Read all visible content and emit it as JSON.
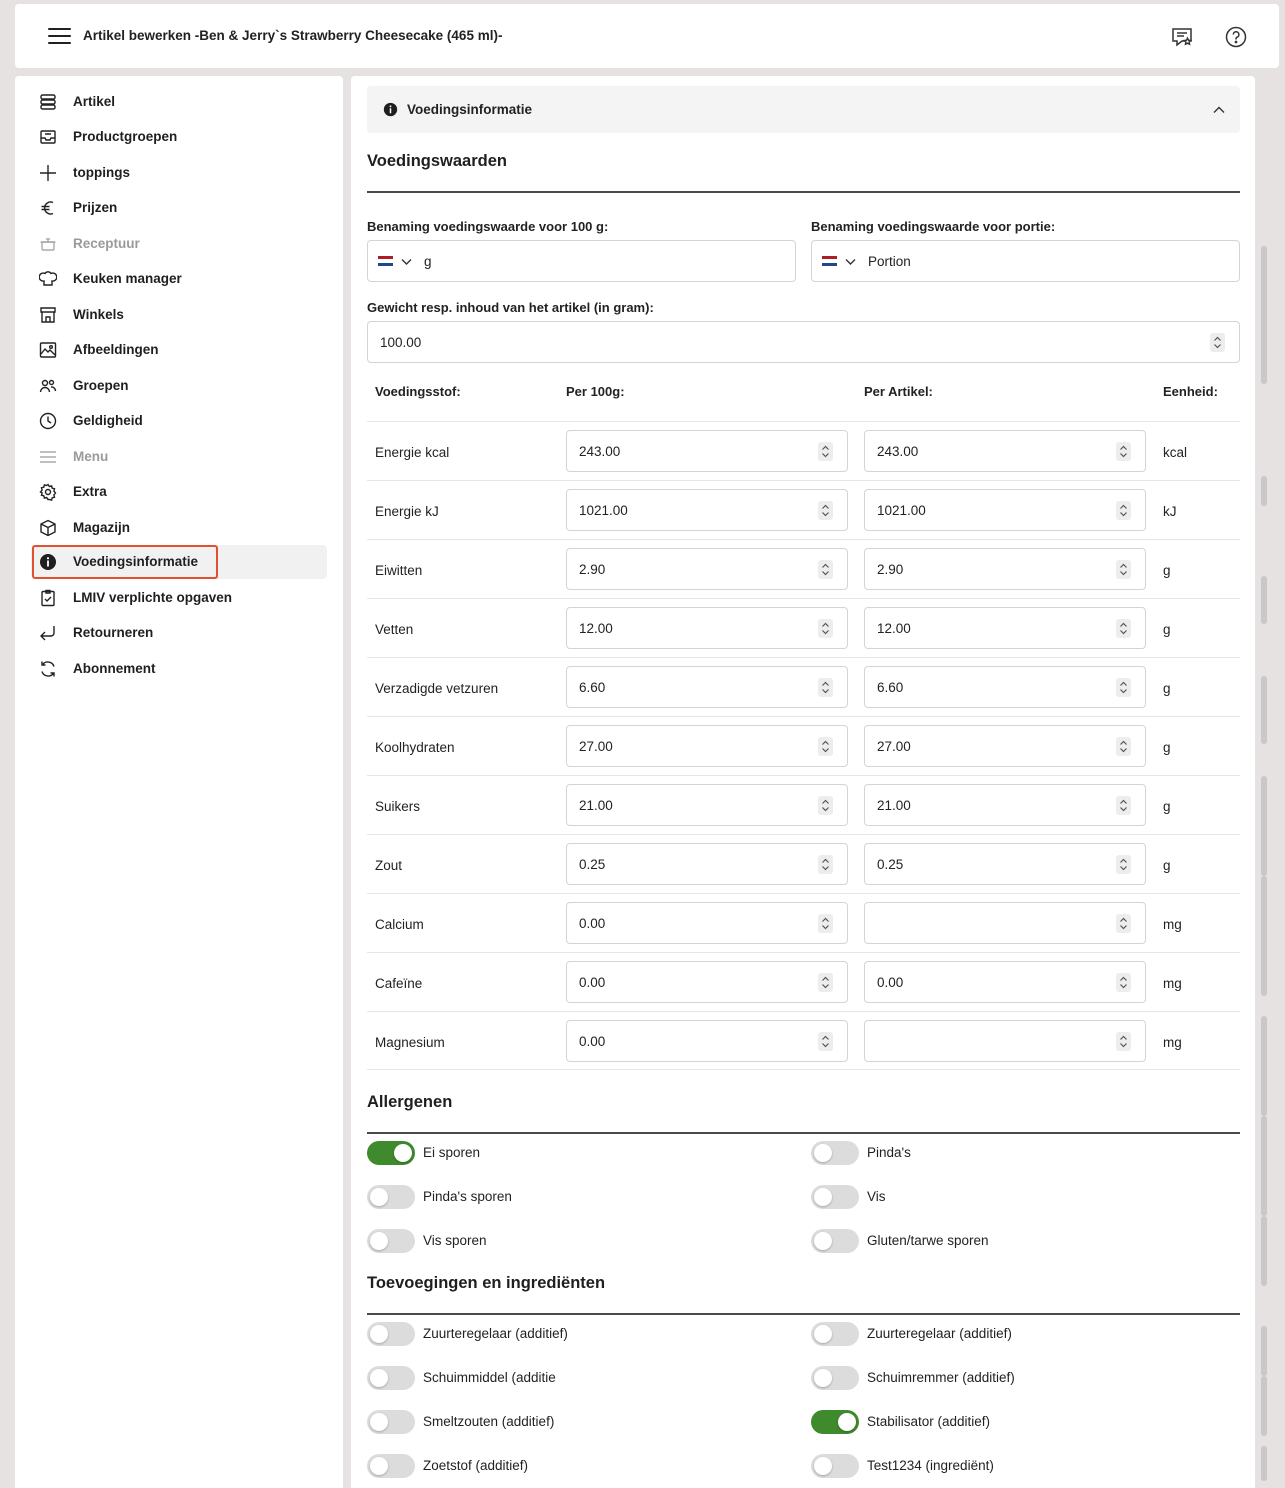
{
  "header": {
    "title": "Artikel bewerken -Ben & Jerry`s Strawberry Cheesecake (465 ml)-",
    "menu_icon": "hamburger-menu-icon",
    "feedback_icon": "feedback-star-icon",
    "help_icon": "help-circle-icon"
  },
  "sidebar": {
    "items": [
      {
        "label": "Artikel",
        "icon": "database-icon"
      },
      {
        "label": "Productgroepen",
        "icon": "inbox-tray-icon"
      },
      {
        "label": "toppings",
        "icon": "plus-icon"
      },
      {
        "label": "Prijzen",
        "icon": "euro-icon"
      },
      {
        "label": "Receptuur",
        "icon": "pot-icon"
      },
      {
        "label": "Keuken manager",
        "icon": "chef-hat-icon"
      },
      {
        "label": "Winkels",
        "icon": "store-icon"
      },
      {
        "label": "Afbeeldingen",
        "icon": "image-icon"
      },
      {
        "label": "Groepen",
        "icon": "users-icon"
      },
      {
        "label": "Geldigheid",
        "icon": "clock-icon"
      },
      {
        "label": "Menu",
        "icon": "list-icon"
      },
      {
        "label": "Extra",
        "icon": "gear-icon"
      },
      {
        "label": "Magazijn",
        "icon": "box-icon"
      },
      {
        "label": "Voedingsinformatie",
        "icon": "info-filled-icon"
      },
      {
        "label": "LMIV verplichte opgaven",
        "icon": "clipboard-check-icon"
      },
      {
        "label": "Retourneren",
        "icon": "return-arrow-icon"
      },
      {
        "label": "Abonnement",
        "icon": "refresh-icon"
      }
    ],
    "active_index": 13,
    "disabled_indices": [
      4,
      10
    ]
  },
  "section": {
    "title": "Voedingsinformatie"
  },
  "nutrition": {
    "heading": "Voedingswaarden",
    "label_100g": "Benaming voedingswaarde voor 100 g:",
    "value_100g": "g",
    "label_portion": "Benaming voedingswaarde voor portie:",
    "value_portion": "Portion",
    "weight_label": "Gewicht resp. inhoud van het artikel (in gram):",
    "weight_value": "100.00",
    "columns": [
      "Voedingsstof:",
      "Per 100g:",
      "Per Artikel:",
      "Eenheid:"
    ],
    "rows": [
      {
        "name": "Energie kcal",
        "per100": "243.00",
        "perArtikel": "243.00",
        "unit": "kcal"
      },
      {
        "name": "Energie kJ",
        "per100": "1021.00",
        "perArtikel": "1021.00",
        "unit": "kJ"
      },
      {
        "name": "Eiwitten",
        "per100": "2.90",
        "perArtikel": "2.90",
        "unit": "g"
      },
      {
        "name": "Vetten",
        "per100": "12.00",
        "perArtikel": "12.00",
        "unit": "g"
      },
      {
        "name": "Verzadigde vetzuren",
        "per100": "6.60",
        "perArtikel": "6.60",
        "unit": "g"
      },
      {
        "name": "Koolhydraten",
        "per100": "27.00",
        "perArtikel": "27.00",
        "unit": "g"
      },
      {
        "name": "Suikers",
        "per100": "21.00",
        "perArtikel": "21.00",
        "unit": "g"
      },
      {
        "name": "Zout",
        "per100": "0.25",
        "perArtikel": "0.25",
        "unit": "g"
      },
      {
        "name": "Calcium",
        "per100": "0.00",
        "perArtikel": "",
        "unit": "mg"
      },
      {
        "name": "Cafeïne",
        "per100": "0.00",
        "perArtikel": "0.00",
        "unit": "mg"
      },
      {
        "name": "Magnesium",
        "per100": "0.00",
        "perArtikel": "",
        "unit": "mg"
      }
    ]
  },
  "allergens": {
    "heading": "Allergenen",
    "items": [
      {
        "label": "Ei sporen",
        "on": true
      },
      {
        "label": "Pinda's",
        "on": false
      },
      {
        "label": "Pinda's sporen",
        "on": false
      },
      {
        "label": "Vis",
        "on": false
      },
      {
        "label": "Vis sporen",
        "on": false
      },
      {
        "label": "Gluten/tarwe sporen",
        "on": false
      }
    ]
  },
  "additives": {
    "heading": "Toevoegingen en ingrediënten",
    "items": [
      {
        "label": "Zuurteregelaar (additief)",
        "on": false
      },
      {
        "label": "Zuurteregelaar (additief)",
        "on": false
      },
      {
        "label": "Schuimmiddel (additie",
        "on": false
      },
      {
        "label": "Schuimremmer (additief)",
        "on": false
      },
      {
        "label": "Smeltzouten (additief)",
        "on": false
      },
      {
        "label": "Stabilisator (additief)",
        "on": true
      },
      {
        "label": "Zoetstof (additief)",
        "on": false
      },
      {
        "label": "Test1234 (ingrediënt)",
        "on": false
      }
    ]
  },
  "colors": {
    "accent_green": "#3e8a2c",
    "active_outline": "#e0522f",
    "flag_red": "#ae1c28",
    "flag_blue": "#21468b"
  }
}
